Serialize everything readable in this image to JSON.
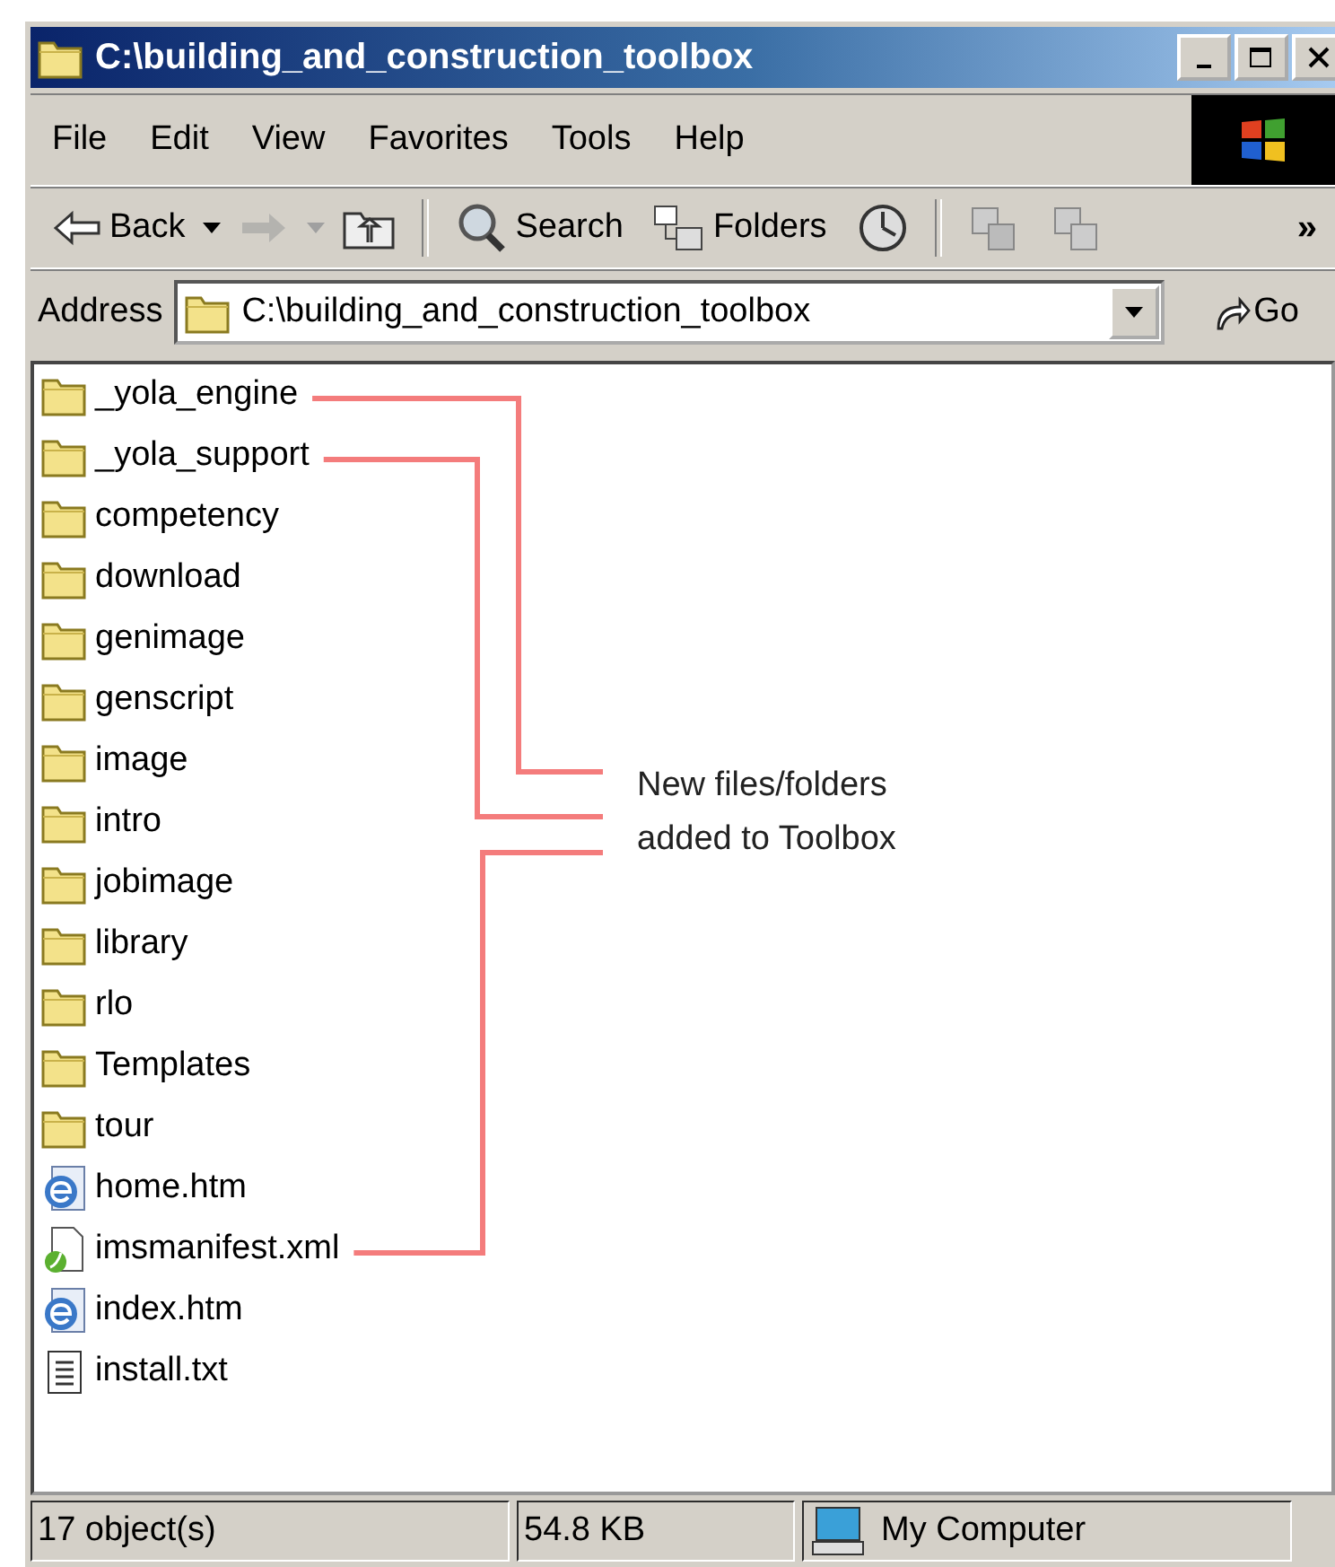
{
  "window": {
    "title": "C:\\building_and_construction_toolbox"
  },
  "menu": [
    {
      "label": "File"
    },
    {
      "label": "Edit"
    },
    {
      "label": "View"
    },
    {
      "label": "Favorites"
    },
    {
      "label": "Tools"
    },
    {
      "label": "Help"
    }
  ],
  "toolbar": {
    "items": [
      {
        "kind": "back",
        "label": "Back",
        "dropdown": true,
        "disabled": false
      },
      {
        "kind": "forward",
        "dropdown": true,
        "disabled": true
      },
      {
        "kind": "up",
        "disabled": false
      },
      {
        "kind": "separator"
      },
      {
        "kind": "search",
        "label": "Search",
        "disabled": false
      },
      {
        "kind": "folders",
        "label": "Folders",
        "disabled": false
      },
      {
        "kind": "history",
        "disabled": false
      },
      {
        "kind": "separator"
      },
      {
        "kind": "move",
        "disabled": false
      },
      {
        "kind": "copy",
        "disabled": false
      }
    ],
    "overflow": "»"
  },
  "address": {
    "label": "Address",
    "value": "C:\\building_and_construction_toolbox",
    "go": "Go"
  },
  "files": [
    {
      "name": "_yola_engine",
      "kind": "folder",
      "annotated": true
    },
    {
      "name": "_yola_support",
      "kind": "folder",
      "annotated": true
    },
    {
      "name": "competency",
      "kind": "folder",
      "annotated": false
    },
    {
      "name": "download",
      "kind": "folder",
      "annotated": false
    },
    {
      "name": "genimage",
      "kind": "folder",
      "annotated": false
    },
    {
      "name": "genscript",
      "kind": "folder",
      "annotated": false
    },
    {
      "name": "image",
      "kind": "folder",
      "annotated": false
    },
    {
      "name": "intro",
      "kind": "folder",
      "annotated": false
    },
    {
      "name": "jobimage",
      "kind": "folder",
      "annotated": false
    },
    {
      "name": "library",
      "kind": "folder",
      "annotated": false
    },
    {
      "name": "rlo",
      "kind": "folder",
      "annotated": false
    },
    {
      "name": "Templates",
      "kind": "folder",
      "annotated": false
    },
    {
      "name": "tour",
      "kind": "folder",
      "annotated": false
    },
    {
      "name": "home.htm",
      "kind": "web",
      "annotated": false
    },
    {
      "name": "imsmanifest.xml",
      "kind": "xml",
      "annotated": true
    },
    {
      "name": "index.htm",
      "kind": "web",
      "annotated": false
    },
    {
      "name": "install.txt",
      "kind": "text",
      "annotated": false
    }
  ],
  "annotation": {
    "text": "New files/folders added to Toolbox"
  },
  "status_bar": {
    "objects": "17 object(s)",
    "size": "54.8 KB",
    "zone": "My Computer"
  }
}
